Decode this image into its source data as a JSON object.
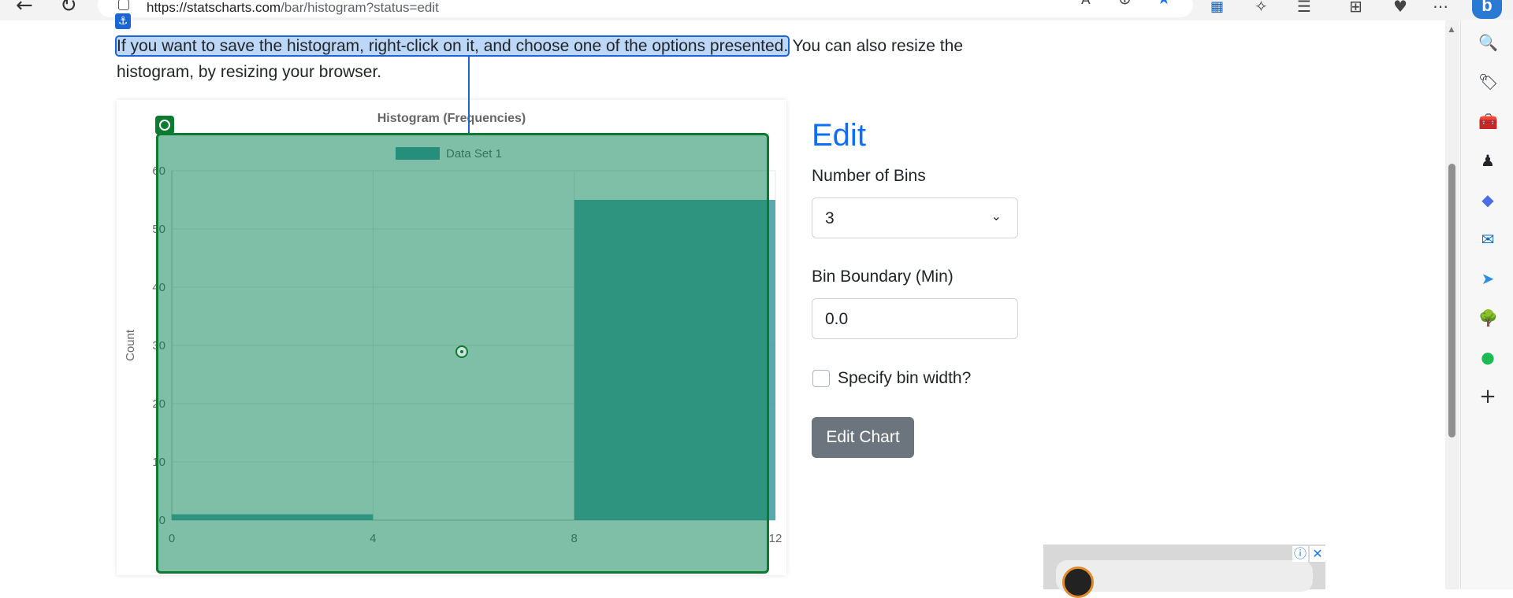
{
  "browser": {
    "url_host": "https://statscharts.com",
    "url_path": "/bar/histogram?status=edit",
    "back_icon": "←",
    "reload_icon": "↻",
    "read_aloud_icon": "A",
    "zoom_icon": "⊕",
    "favorite_icon": "★",
    "more_icon": "⋯"
  },
  "intro": {
    "highlighted": "If you want to save the histogram, right-click on it, and choose one of the options presented.",
    "rest": " You can also resize the histogram, by resizing your browser."
  },
  "chart_data": {
    "type": "bar",
    "title": "Histogram (Frequencies)",
    "ylabel": "Count",
    "xlabel": "",
    "legend": "Data Set 1",
    "legend_position": "top",
    "bins": [
      {
        "from": 0,
        "to": 4,
        "value": 1
      },
      {
        "from": 4,
        "to": 8,
        "value": 0
      },
      {
        "from": 8,
        "to": 12,
        "value": 55
      }
    ],
    "x_ticks": [
      "0",
      "4",
      "8",
      "12"
    ],
    "y_ticks": [
      "0",
      "10",
      "20",
      "30",
      "40",
      "50",
      "60"
    ],
    "ylim": [
      0,
      60
    ],
    "xlim": [
      0,
      12
    ],
    "grid": true,
    "bar_color": "#4a9fa8"
  },
  "form": {
    "title": "Edit",
    "bins_label": "Number of Bins",
    "bins_value": "3",
    "boundary_label": "Bin Boundary (Min)",
    "boundary_value": "0.0",
    "bin_width_label": "Specify bin width?",
    "bin_width_checked": false,
    "submit_label": "Edit Chart"
  },
  "sidebar": {
    "icons": [
      {
        "name": "search-icon",
        "glyph": "🔍"
      },
      {
        "name": "shopping-tag-icon",
        "glyph": "🏷"
      },
      {
        "name": "toolbox-icon",
        "glyph": "🧰"
      },
      {
        "name": "chess-icon",
        "glyph": "♟"
      },
      {
        "name": "copilot-icon",
        "glyph": "◆"
      },
      {
        "name": "outlook-icon",
        "glyph": "✉"
      },
      {
        "name": "send-icon",
        "glyph": "➤"
      },
      {
        "name": "tree-icon",
        "glyph": "🌳"
      },
      {
        "name": "spotify-icon",
        "glyph": "●"
      },
      {
        "name": "add-icon",
        "glyph": "+"
      }
    ]
  },
  "ad": {
    "info_icon": "ⓘ",
    "close_icon": "✕"
  },
  "colors": {
    "accent": "#0d6efd",
    "overlay": "#0c7a2f",
    "highlight": "#1a66d6",
    "button": "#6c757d"
  }
}
